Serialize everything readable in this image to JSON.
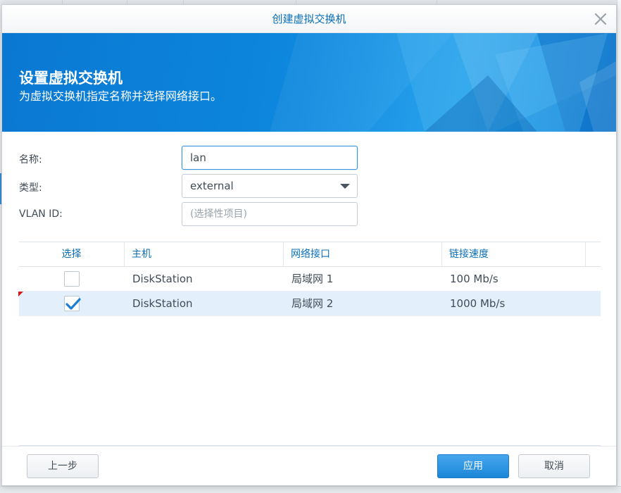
{
  "dialog": {
    "title": "创建虚拟交换机"
  },
  "banner": {
    "title": "设置虚拟交换机",
    "subtitle": "为虚拟交换机指定名称并选择网络接口。"
  },
  "form": {
    "name_label": "名称:",
    "name_value": "lan",
    "type_label": "类型:",
    "type_value": "external",
    "vlan_label": "VLAN ID:",
    "vlan_placeholder": "(选择性项目)"
  },
  "table": {
    "columns": [
      "选择",
      "主机",
      "网络接口",
      "链接速度"
    ],
    "rows": [
      {
        "selected": false,
        "host": "DiskStation",
        "interface": "局域网 1",
        "speed": "100 Mb/s"
      },
      {
        "selected": true,
        "host": "DiskStation",
        "interface": "局域网 2",
        "speed": "1000 Mb/s"
      }
    ]
  },
  "footer": {
    "prev_label": "上一步",
    "apply_label": "应用",
    "cancel_label": "取消"
  },
  "colors": {
    "accent": "#0a6fb8",
    "banner": "#0d86dd",
    "primary_button": "#1b86d9",
    "selected_row": "#e3f0fb",
    "checkmark": "#1a7fd4"
  },
  "icons": {
    "close": "close-icon",
    "dropdown": "chevron-down-icon",
    "check": "checkmark-icon"
  }
}
